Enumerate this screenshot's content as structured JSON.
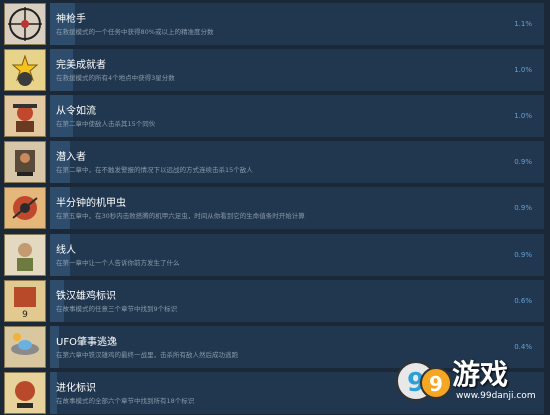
{
  "achievements": [
    {
      "title": "神枪手",
      "desc": "在救援模式的一个任务中获得80%或以上的精准度分数",
      "pct": "1.1%",
      "icon": "crosshair-icon",
      "progress": 0.011
    },
    {
      "title": "完美成就者",
      "desc": "在救援模式的所有4个地点中获得3星分数",
      "pct": "1.0%",
      "icon": "stars-icon",
      "progress": 0.01
    },
    {
      "title": "从令如流",
      "desc": "在第二章中使敌人击杀其15个同伙",
      "pct": "1.0%",
      "icon": "soldier-icon",
      "progress": 0.01
    },
    {
      "title": "潜入者",
      "desc": "在第二章中，在不触发警报的情况下以远战的方式连续击杀15个敌人",
      "pct": "0.9%",
      "icon": "infiltrator-icon",
      "progress": 0.009
    },
    {
      "title": "半分钟的机甲虫",
      "desc": "在第五章中，在30秒内击败搭腾的机甲六足虫，时间从你看到它的生命值条时开始计算",
      "pct": "0.9%",
      "icon": "mech-bug-icon",
      "progress": 0.009
    },
    {
      "title": "线人",
      "desc": "在第一章中让一个人告诉你前方发生了什么",
      "pct": "0.9%",
      "icon": "informant-icon",
      "progress": 0.009
    },
    {
      "title": "铁汉雄鸡标识",
      "desc": "在故事模式的任意三个章节中找到9个标识",
      "pct": "0.6%",
      "icon": "rooster-sign-icon",
      "progress": 0.006
    },
    {
      "title": "UFO肇事逃逸",
      "desc": "在第六章中铁汉雄鸡的最终一战里，击杀所有敌人然后成功逃跑",
      "pct": "0.4%",
      "icon": "ufo-icon",
      "progress": 0.004
    },
    {
      "title": "进化标识",
      "desc": "在故事模式的全部六个章节中找到所有18个标识",
      "pct": "",
      "icon": "evolution-sign-icon",
      "progress": 0.003
    }
  ],
  "watermark": {
    "text": "游戏",
    "url": "www.99danji.com",
    "logo_text": "99"
  }
}
